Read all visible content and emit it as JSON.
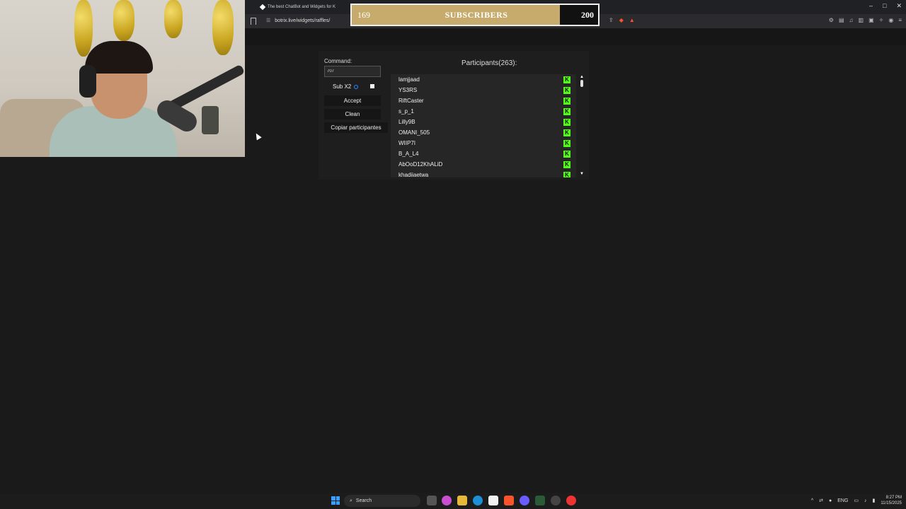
{
  "browser": {
    "tab_title": "The best ChatBot and Widgets for K",
    "url": "botrix.live/widgets/raffles/",
    "window_controls": [
      "–",
      "□",
      "✕"
    ]
  },
  "subscriber_goal": {
    "current": "169",
    "label": "SUBSCRIBERS",
    "target": "200",
    "progress": 0.845,
    "fill_color": "#c7ab6c"
  },
  "raffle": {
    "command_label": "Command:",
    "command_value": "707",
    "sub_label": "Sub X2",
    "buttons": {
      "accept": "Accept",
      "clean": "Clean",
      "copy": "Copiar participantes"
    },
    "participants_title": "Participants(263):",
    "participants": [
      "lamjjaad",
      "YS3RS",
      "RiftCaster",
      "s_p_1",
      "Lilly9B",
      "OMANI_505",
      "WIIP7I",
      "B_A_L4",
      "AbOoD12KhALiD",
      "khadiiaetwa"
    ],
    "kick_icon_color": "#53fc18"
  },
  "taskbar": {
    "search_label": "Search",
    "lang": "ENG",
    "time": "8:27 PM",
    "date": "11/15/2025"
  }
}
